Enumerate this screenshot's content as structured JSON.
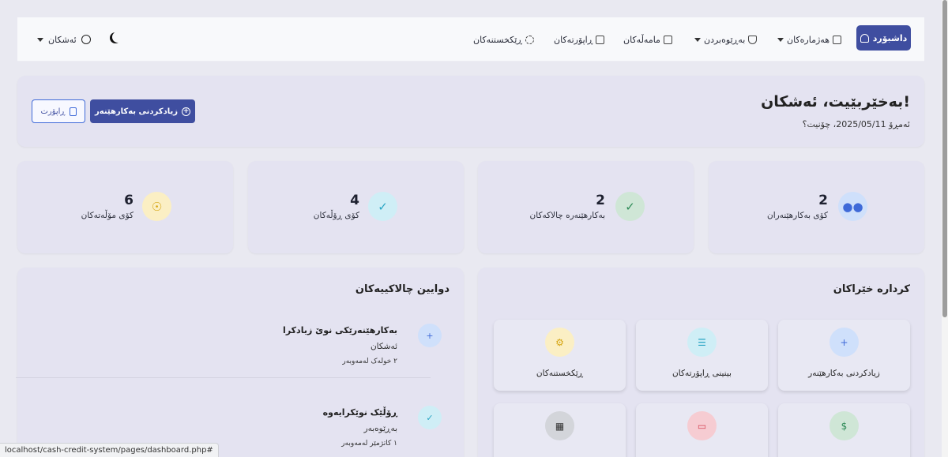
{
  "navbar": {
    "dashboard": "داشبۆرد",
    "accounts": "هەژمارەکان",
    "management": "بەڕێوەبردن",
    "transactions": "مامەڵەکان",
    "reports": "ڕاپۆرتەکان",
    "settings": "ڕێکخستنەکان",
    "user": "ئەشکان"
  },
  "welcome": {
    "title": "بەخێربێیت، ئەشکان!",
    "subtitle": "ئەمڕۆ 2025/05/11، چۆنیت؟",
    "add_user_button": "زیادکردنی بەکارهێنەر",
    "report_button": "ڕاپۆرت"
  },
  "stats": [
    {
      "value": "2",
      "label": "کۆی بەکارهێنەران",
      "icon": "users-icon"
    },
    {
      "value": "2",
      "label": "بەکارهێنەرە چالاکەکان",
      "icon": "user-check-icon"
    },
    {
      "value": "4",
      "label": "کۆی ڕۆڵەکان",
      "icon": "shield-check-icon"
    },
    {
      "value": "6",
      "label": "کۆی مۆڵەتەکان",
      "icon": "key-icon"
    }
  ],
  "quick_actions": {
    "title": "کردارە خێراکان",
    "items": [
      {
        "label": "زیادکردنی بەکارهێنەر",
        "icon": "user-plus-icon"
      },
      {
        "label": "بینینی ڕاپۆرتەکان",
        "icon": "file-text-icon"
      },
      {
        "label": "ڕێکخستنەکان",
        "icon": "gear-icon"
      }
    ]
  },
  "recent_activity": {
    "title": "دوایین چالاکییەکان",
    "items": [
      {
        "title": "بەکارهێنەرێکی نوێ زیادکرا",
        "user": "ئەشکان",
        "time": "٢ خولەک لەمەوبەر",
        "icon": "user-plus-icon"
      },
      {
        "title": "ڕۆڵێک نوێکرایەوە",
        "user": "بەڕێوەبەر",
        "time": "١ کاتژمێر لەمەوبەر",
        "icon": "shield-check-icon"
      }
    ]
  },
  "status_bar": {
    "url": "localhost/cash-credit-system/pages/dashboard.php#"
  },
  "colors": {
    "primary": "#3f4ea0",
    "card_bg": "#e4e3f1",
    "page_bg": "#e9e9f1"
  }
}
